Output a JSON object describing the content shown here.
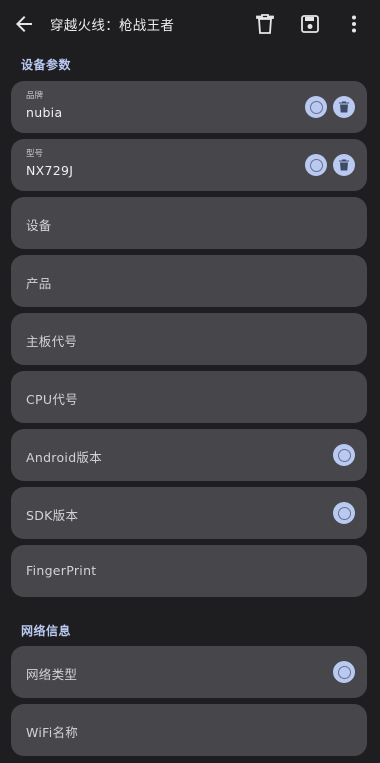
{
  "appbar": {
    "title": "穿越火线：枪战王者",
    "icons": [
      "back-arrow-icon",
      "delete-icon",
      "save-icon",
      "more-vert-icon"
    ]
  },
  "sections": {
    "device": "设备参数",
    "network": "网络信息"
  },
  "fields": {
    "brand": {
      "label": "品牌",
      "value": "nubia"
    },
    "model": {
      "label": "型号",
      "value": "NX729J"
    },
    "device": {
      "label": "设备"
    },
    "product": {
      "label": "产品"
    },
    "board": {
      "label": "主板代号"
    },
    "cpu": {
      "label": "CPU代号"
    },
    "android": {
      "label": "Android版本"
    },
    "sdk": {
      "label": "SDK版本"
    },
    "fingerprint": {
      "label": "FingerPrint"
    },
    "net_type": {
      "label": "网络类型"
    },
    "wifi_name": {
      "label": "WiFi名称"
    }
  },
  "colors": {
    "background": "#1e1e20",
    "card": "#46464b",
    "accent": "#b9c9f1"
  }
}
